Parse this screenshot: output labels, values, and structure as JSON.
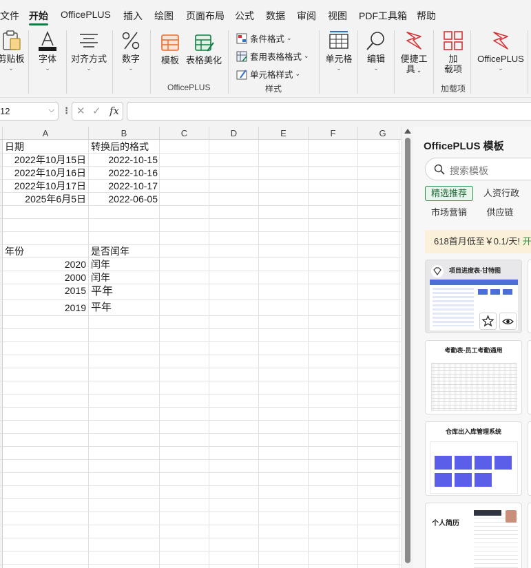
{
  "menu": {
    "tabs": [
      {
        "label": "文件"
      },
      {
        "label": "开始"
      },
      {
        "label": "OfficePLUS"
      },
      {
        "label": "插入"
      },
      {
        "label": "绘图"
      },
      {
        "label": "页面布局"
      },
      {
        "label": "公式"
      },
      {
        "label": "数据"
      },
      {
        "label": "审阅"
      },
      {
        "label": "视图"
      },
      {
        "label": "PDF工具箱"
      },
      {
        "label": "帮助"
      }
    ],
    "active_tab": "开始"
  },
  "ribbon": {
    "clipboard": "剪贴板",
    "font": "字体",
    "align": "对齐方式",
    "number": "数字",
    "template": "模板",
    "table_beautify": "表格美化",
    "officeplus_group": "OfficePLUS",
    "cond_format": "条件格式",
    "table_format": "套用表格格式",
    "cell_style": "单元格样式",
    "style_group": "样式",
    "cells": "单元格",
    "edit": "编辑",
    "quick_tools_1": "便捷工",
    "quick_tools_2": "具",
    "addin_1": "加",
    "addin_2": "载项",
    "addin_group": "加载项",
    "officeplus_btn": "OfficePLUS"
  },
  "formula_bar": {
    "name_box": "12",
    "fx": "fx",
    "value": ""
  },
  "sheet": {
    "columns": [
      "A",
      "B",
      "C",
      "D",
      "E",
      "F",
      "G"
    ],
    "rows": [
      {
        "a": "日期",
        "b": "转换后的格式"
      },
      {
        "a": "2022年10月15日",
        "b": "2022-10-15"
      },
      {
        "a": "2022年10月16日",
        "b": "2022-10-16"
      },
      {
        "a": "2022年10月17日",
        "b": "2022-10-17"
      },
      {
        "a": "2025年6月5日",
        "b": "2022-06-05"
      },
      {
        "a": "年份",
        "b": "是否闰年"
      },
      {
        "a": "2020",
        "b": "闰年"
      },
      {
        "a": "2000",
        "b": "闰年"
      },
      {
        "a": "2015",
        "b": "平年"
      },
      {
        "a": "2019",
        "b": "平年"
      }
    ]
  },
  "panel": {
    "title": "OfficePLUS 模板",
    "search_placeholder": "搜索模板",
    "chips": [
      {
        "label": "精选推荐",
        "selected": true
      },
      {
        "label": "人资行政",
        "selected": false
      },
      {
        "label": "市场营销",
        "selected": false
      },
      {
        "label": "供应链",
        "selected": false
      }
    ],
    "promo_text": "618首月低至￥0.1/天!",
    "promo_link": "开",
    "cards": [
      {
        "title": "项目进度表-甘特图"
      },
      {
        "title": "考勤表-员工考勤通用"
      },
      {
        "title": "仓库出入库管理系统"
      },
      {
        "title": "个人简历"
      }
    ]
  },
  "colors": {
    "accent": "#107c41",
    "chip_green": "#2f8f4a",
    "promo_bg": "#fbf0d8",
    "officeplus_red": "#d13438",
    "template_orange": "#e8692b",
    "card_blue": "#5b5ee8"
  }
}
